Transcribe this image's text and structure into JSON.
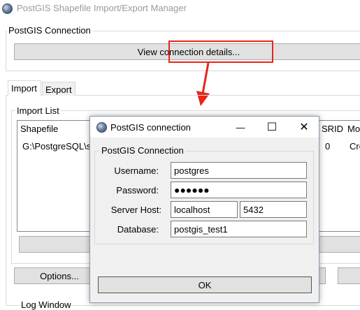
{
  "app": {
    "title": "PostGIS Shapefile Import/Export Manager",
    "connection_group": "PostGIS Connection",
    "view_connection_button": "View connection details...",
    "tabs": [
      "Import",
      "Export"
    ],
    "import_list_group": "Import List",
    "columns": [
      "Shapefile",
      "SRID",
      "Mo"
    ],
    "rows": [
      {
        "shapefile": "G:\\PostgreSQL\\s",
        "srid": "0",
        "mode": "Cre"
      }
    ],
    "options_button": "Options...",
    "log_label": "Log Window"
  },
  "dialog": {
    "title": "PostGIS connection",
    "group_label": "PostGIS Connection",
    "username_label": "Username:",
    "username_value": "postgres",
    "password_label": "Password:",
    "password_value": "●●●●●●",
    "host_label": "Server Host:",
    "host_value": "localhost",
    "port_value": "5432",
    "database_label": "Database:",
    "database_value": "postgis_test1",
    "ok_button": "OK",
    "minimize_glyph": "—",
    "maximize_glyph": "☐",
    "close_glyph": "✕"
  },
  "colors": {
    "highlight": "#e8241b",
    "dialog_bg": "#f0f0f0",
    "button_bg": "#e1e1e1"
  }
}
